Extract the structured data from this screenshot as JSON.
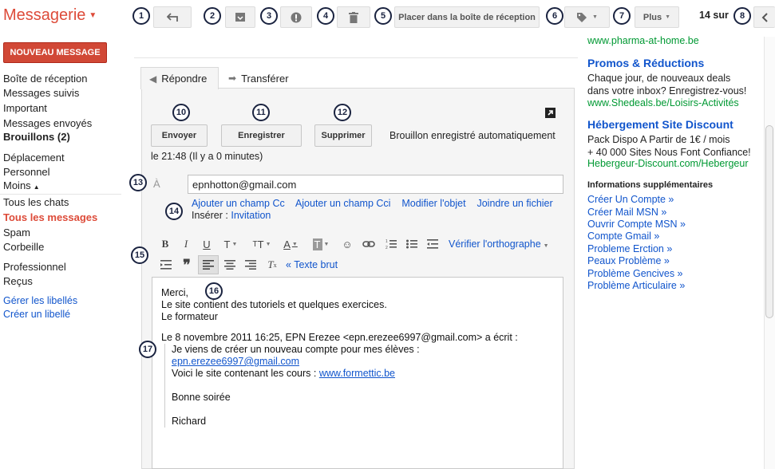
{
  "app": {
    "title": "Messagerie"
  },
  "toolbar": {
    "move_to_inbox": "Placer dans la boîte de réception",
    "more": "Plus",
    "pagination": "14 sur"
  },
  "sidebar": {
    "compose": "NOUVEAU MESSAGE",
    "items": [
      "Boîte de réception",
      "Messages suivis",
      "Important",
      "Messages envoyés",
      "Brouillons (2)",
      "Déplacement",
      "Personnel",
      "Moins",
      "Tous les chats",
      "Tous les messages",
      "Spam",
      "Corbeille",
      "Professionnel",
      "Reçus",
      "Gérer les libellés",
      "Créer un libellé"
    ]
  },
  "compose": {
    "tab_reply": "Répondre",
    "tab_forward": "Transférer",
    "send": "Envoyer",
    "save": "Enregistrer",
    "delete": "Supprimer",
    "autosave": "Brouillon enregistré automatiquement",
    "autosave_time": "le 21:48 (Il y a 0 minutes)",
    "to_label": "À",
    "to_value": "epnhotton@gmail.com",
    "add_cc": "Ajouter un champ Cc",
    "add_bcc": "Ajouter un champ Cci",
    "edit_subject": "Modifier l'objet",
    "attach": "Joindre un fichier",
    "insert_label": "Insérer :",
    "invitation": "Invitation",
    "spellcheck": "Vérifier l'orthographe",
    "plain_text": "« Texte brut",
    "body": {
      "line1": "Merci,",
      "line2": "Le site contient des tutoriels et quelques exercices.",
      "line3": "Le formateur",
      "quote_header": "Le 8 novembre 2011 16:25, EPN Erezee <epn.erezee6997@gmail.com> a écrit :",
      "q1": "Je viens de créer un nouveau compte pour mes élèves :",
      "q2": "epn.erezee6997@gmail.com",
      "q3_prefix": "Voici le site contenant les cours : ",
      "q3_link": "www.formettic.be",
      "q4": "Bonne soirée",
      "q5": "Richard"
    }
  },
  "ads": {
    "top_url": "www.pharma-at-home.be",
    "ad1_title": "Promos & Réductions",
    "ad1_line1": "Chaque jour, de nouveaux deals",
    "ad1_line2": "dans votre inbox? Enregistrez-vous!",
    "ad1_url": "www.Shedeals.be/Loisirs-Activités",
    "ad2_title": "Hébergement Site Discount",
    "ad2_line1": "Pack Dispo A Partir de 1€ / mois",
    "ad2_line2": "+ 40 000 Sites Nous Font Confiance!",
    "ad2_url": "Hebergeur-Discount.com/Hebergeur",
    "more_info": "Informations supplémentaires",
    "links": [
      "Créer Un Compte »",
      "Créer Mail MSN »",
      "Ouvrir Compte MSN »",
      "Compte Gmail »",
      "Probleme Erction »",
      "Peaux Problème »",
      "Problème Gencives »",
      "Problème Articulaire »"
    ]
  },
  "badges": [
    "1",
    "2",
    "3",
    "4",
    "5",
    "6",
    "7",
    "8",
    "10",
    "11",
    "12",
    "13",
    "14",
    "15",
    "16",
    "17"
  ],
  "colors": {
    "brand_red": "#dd4b39",
    "compose_red": "#d14836",
    "link_blue": "#1155cc",
    "ad_green": "#009933"
  }
}
